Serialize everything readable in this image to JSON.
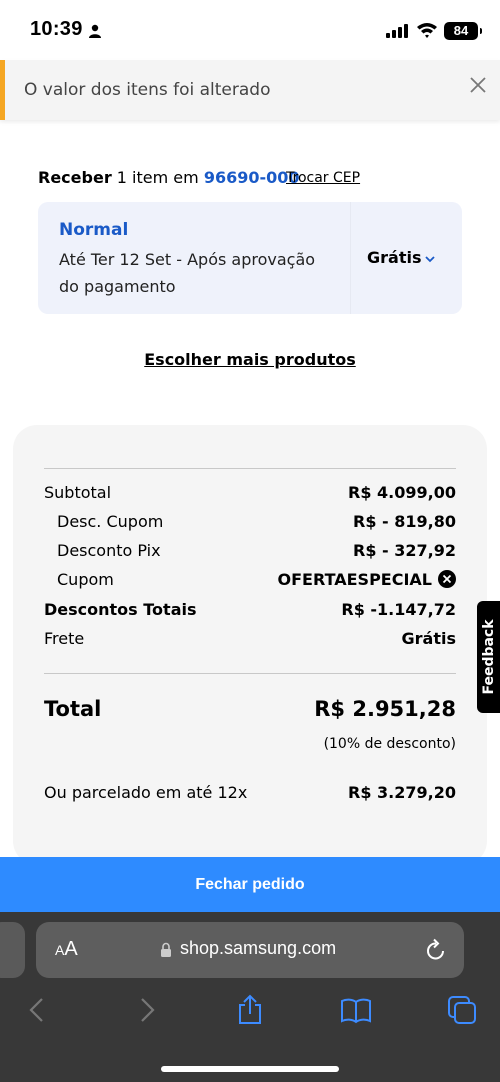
{
  "status_bar": {
    "time": "10:39",
    "battery": "84"
  },
  "banner": {
    "message": "O valor dos itens foi alterado"
  },
  "delivery": {
    "receive_prefix": "Receber",
    "receive_middle": " 1 item em ",
    "cep": "96690-000",
    "change_cep": "Trocar CEP",
    "option_name": "Normal",
    "option_desc": "Até Ter 12 Set - Após aprovação do pagamento",
    "option_price": "Grátis"
  },
  "more_products": "Escolher mais produtos",
  "summary": {
    "rows": [
      {
        "label": "Subtotal",
        "value": "R$ 4.099,00"
      },
      {
        "label": "Desc. Cupom",
        "value": "R$ - 819,80"
      },
      {
        "label": "Desconto Pix",
        "value": "R$ - 327,92"
      },
      {
        "label": "Cupom",
        "value": "OFERTAESPECIAL"
      },
      {
        "label": "Descontos Totais",
        "value": "R$ -1.147,72"
      },
      {
        "label": "Frete",
        "value": "Grátis"
      }
    ],
    "total_label": "Total",
    "total_value": "R$ 2.951,28",
    "discount_note": "(10% de desconto)",
    "installment_label": "Ou parcelado em até 12x",
    "installment_value": "R$ 3.279,20"
  },
  "feedback_label": "Feedback",
  "checkout_label": "Fechar pedido",
  "browser": {
    "aa_label": "AA",
    "url": "shop.samsung.com"
  },
  "colors": {
    "accent": "#2e8bff",
    "link": "#1a5ac7",
    "banner_stripe": "#f5a623"
  }
}
